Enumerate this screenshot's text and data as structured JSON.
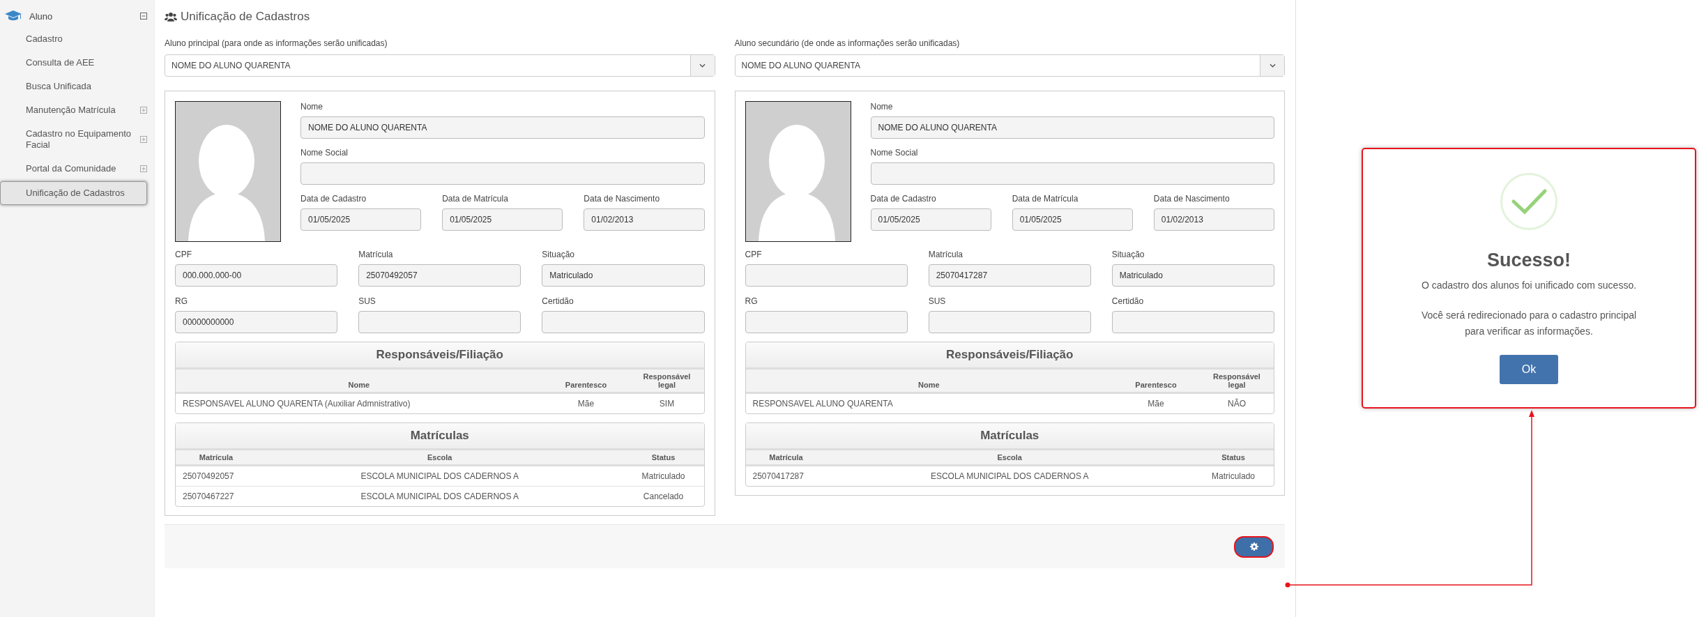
{
  "sidebar": {
    "header": {
      "label": "Aluno",
      "expanded": true
    },
    "items": [
      {
        "label": "Cadastro",
        "kind": "leaf",
        "selected": false
      },
      {
        "label": "Consulta de AEE",
        "kind": "leaf",
        "selected": false
      },
      {
        "label": "Busca Unificada",
        "kind": "leaf",
        "selected": false
      },
      {
        "label": "Manutenção Matrícula",
        "kind": "group",
        "expanded": false,
        "selected": false
      },
      {
        "label": "Cadastro no Equipamento Facial",
        "kind": "group",
        "expanded": false,
        "selected": false
      },
      {
        "label": "Portal da Comunidade",
        "kind": "group",
        "expanded": false,
        "selected": false
      },
      {
        "label": "Unificação de Cadastros",
        "kind": "leaf",
        "selected": true
      }
    ]
  },
  "page_title": "Unificação de Cadastros",
  "students": [
    {
      "select_label": "Aluno principal (para onde as informações serão unificadas)",
      "selected_name": "NOME DO ALUNO QUARENTA",
      "name_fields": [
        {
          "label": "Nome",
          "value": "NOME DO ALUNO QUARENTA"
        },
        {
          "label": "Nome Social"
        }
      ],
      "date_fields": [
        {
          "label": "Data de Cadastro",
          "value": "01/05/2025"
        },
        {
          "label": "Data de Matrícula",
          "value": "01/05/2025"
        },
        {
          "label": "Data de Nascimento",
          "value": "01/02/2013"
        }
      ],
      "doc_fields": [
        {
          "label": "CPF",
          "value": "000.000.000-00"
        },
        {
          "label": "Matrícula",
          "value": "25070492057"
        },
        {
          "label": "Situação",
          "value": "Matriculado"
        },
        {
          "label": "RG",
          "value": "00000000000"
        },
        {
          "label": "SUS"
        },
        {
          "label": "Certidão"
        }
      ],
      "guardians": {
        "title": "Responsáveis/Filiação",
        "columns": [
          "Nome",
          "Parentesco",
          "Responsável legal"
        ],
        "rows": [
          [
            "RESPONSAVEL ALUNO QUARENTA (Auxiliar Admnistrativo)",
            "Mãe",
            "SIM"
          ]
        ]
      },
      "enrollments": {
        "title": "Matrículas",
        "columns": [
          "Matrícula",
          "Escola",
          "Status"
        ],
        "rows": [
          [
            "25070492057",
            "ESCOLA MUNICIPAL DOS CADERNOS A",
            "Matriculado"
          ],
          [
            "25070467227",
            "ESCOLA MUNICIPAL DOS CADERNOS A",
            "Cancelado"
          ]
        ]
      }
    },
    {
      "select_label": "Aluno secundário (de onde as informações serão unificadas)",
      "selected_name": "NOME DO ALUNO QUARENTA",
      "name_fields": [
        {
          "label": "Nome",
          "value": "NOME DO ALUNO QUARENTA"
        },
        {
          "label": "Nome Social"
        }
      ],
      "date_fields": [
        {
          "label": "Data de Cadastro",
          "value": "01/05/2025"
        },
        {
          "label": "Data de Matrícula",
          "value": "01/05/2025"
        },
        {
          "label": "Data de Nascimento",
          "value": "01/02/2013"
        }
      ],
      "doc_fields": [
        {
          "label": "CPF"
        },
        {
          "label": "Matrícula",
          "value": "25070417287"
        },
        {
          "label": "Situação",
          "value": "Matriculado"
        },
        {
          "label": "RG"
        },
        {
          "label": "SUS"
        },
        {
          "label": "Certidão"
        }
      ],
      "guardians": {
        "title": "Responsáveis/Filiação",
        "columns": [
          "Nome",
          "Parentesco",
          "Responsável legal"
        ],
        "rows": [
          [
            "RESPONSAVEL ALUNO QUARENTA",
            "Mãe",
            "NÃO"
          ]
        ]
      },
      "enrollments": {
        "title": "Matrículas",
        "columns": [
          "Matrícula",
          "Escola",
          "Status"
        ],
        "rows": [
          [
            "25070417287",
            "ESCOLA MUNICIPAL DOS CADERNOS A",
            "Matriculado"
          ]
        ]
      }
    }
  ],
  "footer": {
    "settings_button": {
      "highlighted": true
    }
  },
  "dialog": {
    "highlighted": true,
    "title": "Sucesso!",
    "message": "O cadastro dos alunos foi unificado com sucesso.",
    "note": "Você será redirecionado para o cadastro principal para verificar as informações.",
    "button": "Ok"
  }
}
